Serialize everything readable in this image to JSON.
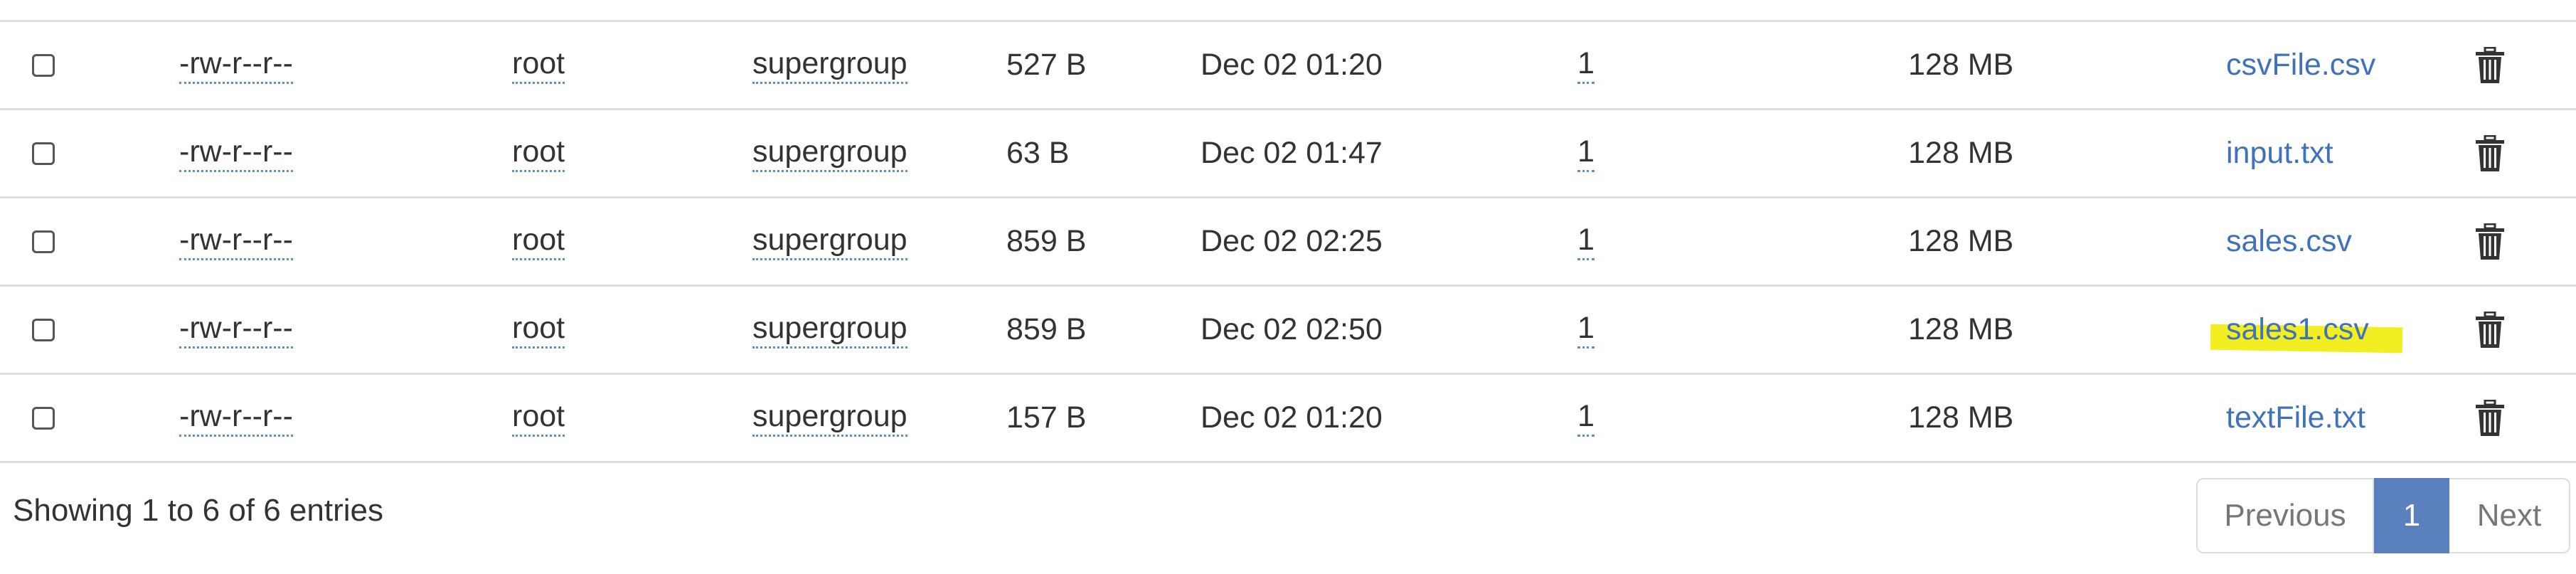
{
  "rows": [
    {
      "permission": "-rw-r--r--",
      "owner": "root",
      "group": "supergroup",
      "size": "527 B",
      "last_modified": "Dec 02 01:20",
      "replication": "1",
      "block_size": "128 MB",
      "name": "csvFile.csv"
    },
    {
      "permission": "-rw-r--r--",
      "owner": "root",
      "group": "supergroup",
      "size": "63 B",
      "last_modified": "Dec 02 01:47",
      "replication": "1",
      "block_size": "128 MB",
      "name": "input.txt"
    },
    {
      "permission": "-rw-r--r--",
      "owner": "root",
      "group": "supergroup",
      "size": "859 B",
      "last_modified": "Dec 02 02:25",
      "replication": "1",
      "block_size": "128 MB",
      "name": "sales.csv"
    },
    {
      "permission": "-rw-r--r--",
      "owner": "root",
      "group": "supergroup",
      "size": "859 B",
      "last_modified": "Dec 02 02:50",
      "replication": "1",
      "block_size": "128 MB",
      "name": "sales1.csv",
      "highlighted": true
    },
    {
      "permission": "-rw-r--r--",
      "owner": "root",
      "group": "supergroup",
      "size": "157 B",
      "last_modified": "Dec 02 01:20",
      "replication": "1",
      "block_size": "128 MB",
      "name": "textFile.txt"
    }
  ],
  "footer": {
    "info": "Showing 1 to 6 of 6 entries"
  },
  "pagination": {
    "previous_label": "Previous",
    "current_page": "1",
    "next_label": "Next"
  },
  "colors": {
    "link": "#3f72b8",
    "highlight": "#f2ee21",
    "active_page": "#5a80bd"
  },
  "icons": {
    "delete": "trash-icon"
  }
}
